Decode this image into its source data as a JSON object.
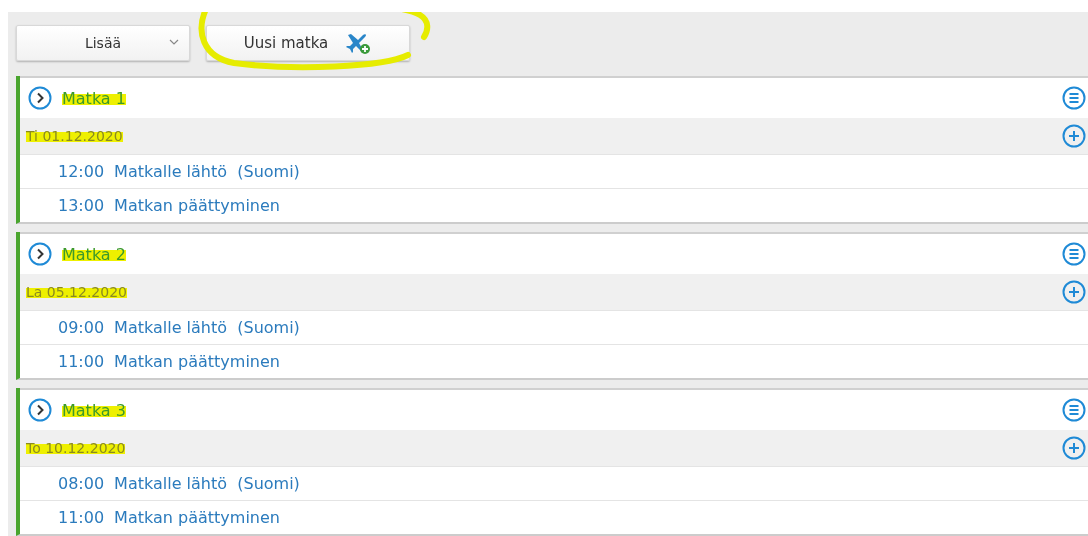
{
  "toolbar": {
    "more_button": {
      "label": "Lisää"
    },
    "new_trip_button": {
      "label": "Uusi matka",
      "annotated": true
    }
  },
  "trips": [
    {
      "title": "Matka 1",
      "highlighted": true,
      "days": [
        {
          "date": "Ti 01.12.2020",
          "highlighted": true,
          "events": [
            {
              "time": "12:00",
              "label": "Matkalle lähtö  (Suomi)"
            },
            {
              "time": "13:00",
              "label": "Matkan päättyminen"
            }
          ]
        }
      ]
    },
    {
      "title": "Matka 2",
      "highlighted": true,
      "days": [
        {
          "date": "La 05.12.2020",
          "highlighted": true,
          "events": [
            {
              "time": "09:00",
              "label": "Matkalle lähtö  (Suomi)"
            },
            {
              "time": "11:00",
              "label": "Matkan päättyminen"
            }
          ]
        }
      ]
    },
    {
      "title": "Matka 3",
      "highlighted": true,
      "days": [
        {
          "date": "To 10.12.2020",
          "highlighted": true,
          "events": [
            {
              "time": "08:00",
              "label": "Matkalle lähtö  (Suomi)"
            },
            {
              "time": "11:00",
              "label": "Matkan päättyminen"
            }
          ]
        }
      ]
    }
  ]
}
